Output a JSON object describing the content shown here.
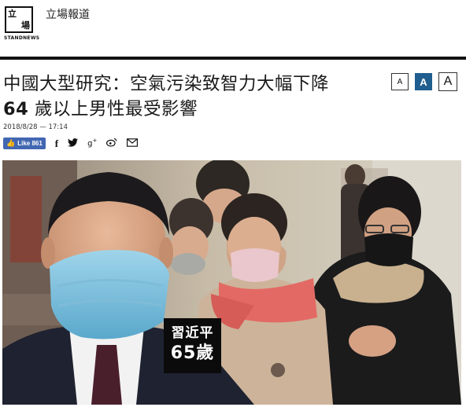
{
  "header": {
    "logo_top": "立",
    "logo_bottom": "場",
    "logo_sub": "STANDNEWS",
    "site_name": "立場報道"
  },
  "article": {
    "title_line1": "中國大型研究：空氣污染致智力大幅下降",
    "title_line2_num": "64",
    "title_line2_rest": " 歲以上男性最受影響",
    "timestamp": "2018/8/28 — 17:14"
  },
  "font_size_buttons": [
    "A",
    "A",
    "A"
  ],
  "share": {
    "like_label": "Like 861",
    "icons": [
      "facebook-icon",
      "twitter-icon",
      "google-plus-icon",
      "weibo-icon",
      "email-icon"
    ]
  },
  "image_caption": {
    "line1": "習近平",
    "line2": "65歲"
  },
  "colors": {
    "accent": "#1f5e8e",
    "facebook": "#4267b2",
    "rule": "#111111"
  }
}
